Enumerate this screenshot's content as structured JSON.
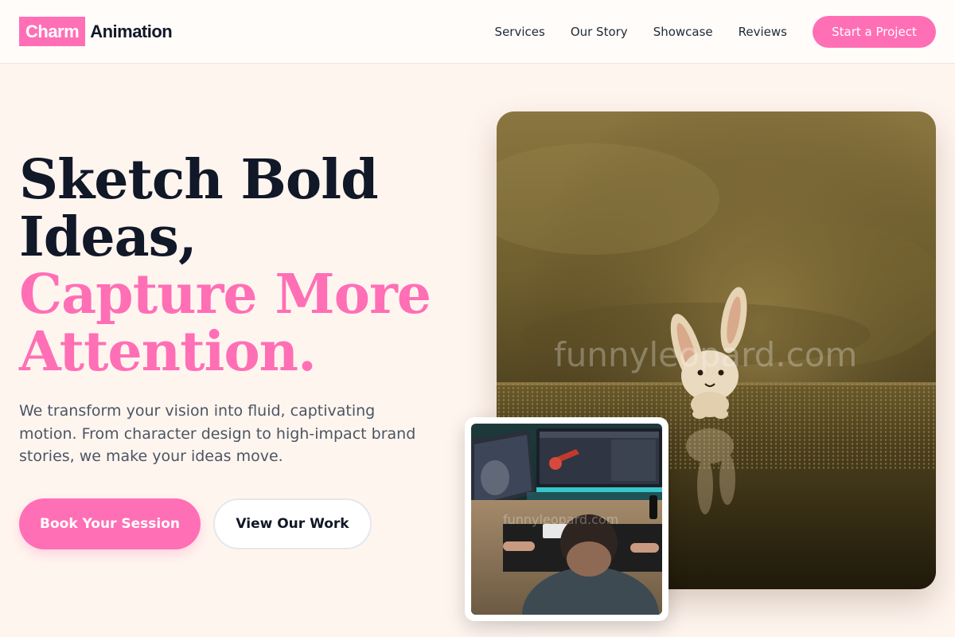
{
  "brand": {
    "badge": "Charm",
    "name": "Animation",
    "accent": "#ff6fb5"
  },
  "nav": {
    "links": [
      "Services",
      "Our Story",
      "Showcase",
      "Reviews"
    ],
    "cta": "Start a Project"
  },
  "hero": {
    "headline_dark": [
      "Sketch Bold",
      "Ideas,"
    ],
    "headline_pink": [
      "Capture More",
      "Attention."
    ],
    "subtitle": "We transform your vision into fluid, captivating motion. From character design to high-impact brand stories, we make your ideas move.",
    "primary_button": "Book Your Session",
    "secondary_button": "View Our Work"
  },
  "images": {
    "main_watermark": "funnyleopard.com",
    "inset_watermark": "funnyleopard.com"
  }
}
